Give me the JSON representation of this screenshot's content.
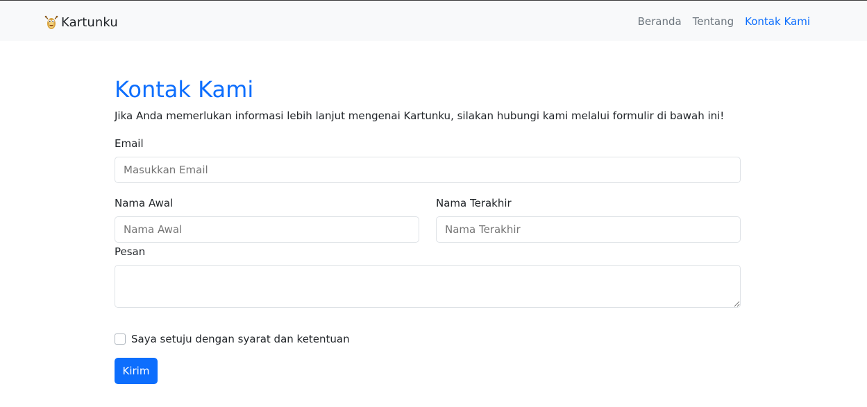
{
  "navbar": {
    "brand": "Kartunku",
    "logo_icon": "cartoon-mascot-icon",
    "links": [
      {
        "label": "Beranda",
        "active": false
      },
      {
        "label": "Tentang",
        "active": false
      },
      {
        "label": "Kontak Kami",
        "active": true
      }
    ]
  },
  "page": {
    "title": "Kontak Kami",
    "lead": "Jika Anda memerlukan informasi lebih lanjut mengenai Kartunku, silakan hubungi kami melalui formulir di bawah ini!"
  },
  "form": {
    "email_label": "Email",
    "email_placeholder": "Masukkan Email",
    "first_name_label": "Nama Awal",
    "first_name_placeholder": "Nama Awal",
    "last_name_label": "Nama Terakhir",
    "last_name_placeholder": "Nama Terakhir",
    "message_label": "Pesan",
    "message_value": "",
    "agree_label": "Saya setuju dengan syarat dan ketentuan",
    "agree_checked": false,
    "submit_label": "Kirim"
  },
  "colors": {
    "primary": "#0d6efd",
    "navbar_bg": "#f8f9fa",
    "nav_link": "#6c757d"
  }
}
